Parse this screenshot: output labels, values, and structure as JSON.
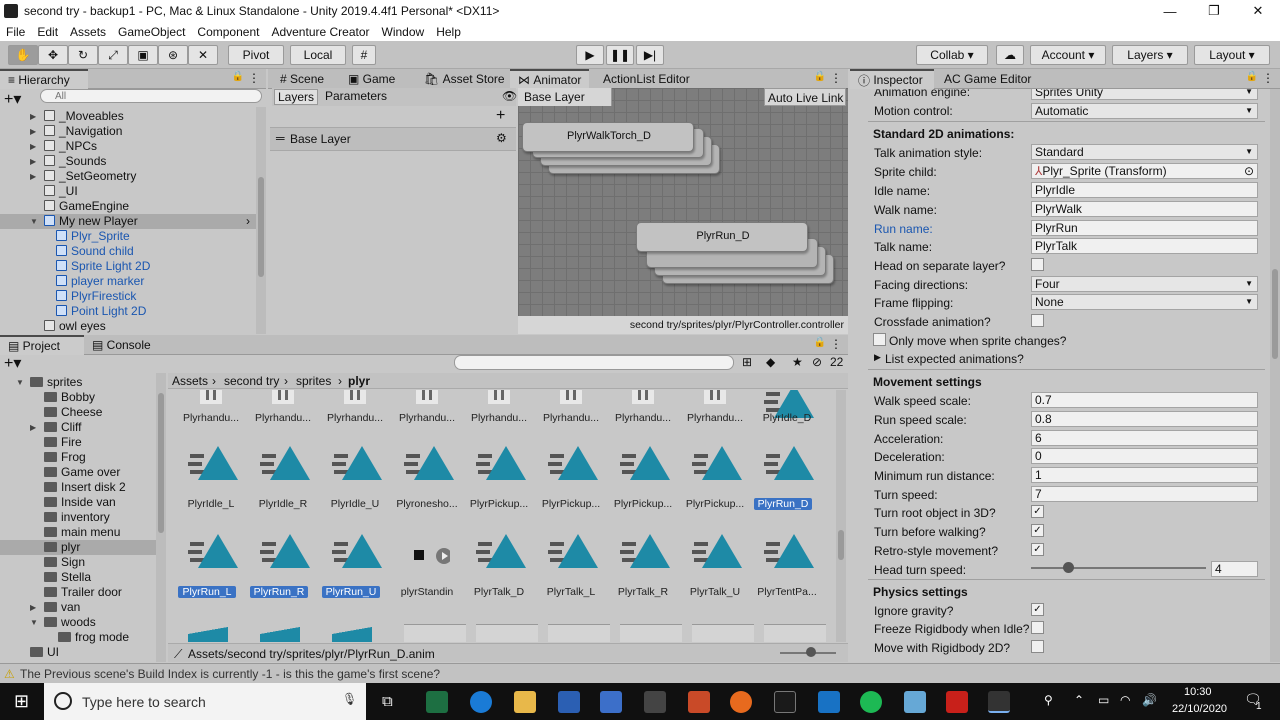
{
  "window": {
    "title": "second try - backup1 - PC, Mac & Linux Standalone - Unity 2019.4.4f1 Personal* <DX11>",
    "min_glyph": "—",
    "max_glyph": "❐",
    "close_glyph": "✕"
  },
  "menu": [
    "File",
    "Edit",
    "Assets",
    "GameObject",
    "Component",
    "Adventure Creator",
    "Window",
    "Help"
  ],
  "toolbar": {
    "pivot": "Pivot",
    "local": "Local",
    "collab": "Collab ▾",
    "account": "Account",
    "layers": "Layers",
    "layout": "Layout"
  },
  "hierarchy": {
    "tab": "Hierarchy",
    "search_placeholder": "All",
    "items": [
      {
        "label": "_Moveables",
        "indent": 1,
        "arrow": "▶",
        "blue": false,
        "cube": true
      },
      {
        "label": "_Navigation",
        "indent": 1,
        "arrow": "▶",
        "blue": false,
        "cube": true
      },
      {
        "label": "_NPCs",
        "indent": 1,
        "arrow": "▶",
        "blue": false,
        "cube": true
      },
      {
        "label": "_Sounds",
        "indent": 1,
        "arrow": "▶",
        "blue": false,
        "cube": true
      },
      {
        "label": "_SetGeometry",
        "indent": 1,
        "arrow": "▶",
        "blue": false,
        "cube": true
      },
      {
        "label": "_UI",
        "indent": 1,
        "arrow": "",
        "blue": false,
        "cube": true
      },
      {
        "label": "GameEngine",
        "indent": 1,
        "arrow": "",
        "blue": false,
        "cube": true
      },
      {
        "label": "My new Player",
        "indent": 1,
        "arrow": "▼",
        "blue": false,
        "cube": true,
        "selected": true
      },
      {
        "label": "Plyr_Sprite",
        "indent": 2,
        "arrow": "",
        "blue": true,
        "cube": true
      },
      {
        "label": "Sound child",
        "indent": 2,
        "arrow": "",
        "blue": true,
        "cube": true
      },
      {
        "label": "Sprite Light 2D",
        "indent": 2,
        "arrow": "",
        "blue": true,
        "cube": true
      },
      {
        "label": "player marker",
        "indent": 2,
        "arrow": "",
        "blue": true,
        "cube": true
      },
      {
        "label": "PlyrFirestick",
        "indent": 2,
        "arrow": "",
        "blue": true,
        "cube": true
      },
      {
        "label": "Point Light 2D",
        "indent": 2,
        "arrow": "",
        "blue": true,
        "cube": true
      },
      {
        "label": "owl eyes",
        "indent": 1,
        "arrow": "",
        "blue": false,
        "cube": true
      }
    ]
  },
  "center_tabs": [
    "Scene",
    "Game",
    "Asset Store",
    "Animator",
    "ActionList Editor"
  ],
  "animator": {
    "layers_tab": "Layers",
    "parameters_tab": "Parameters",
    "base_layer": "Base Layer",
    "breadcrumb": "Base Layer",
    "auto_live": "Auto Live Link",
    "node1": "PlyrWalkTorch_D",
    "node2": "PlyrRun_D",
    "path": "second try/sprites/plyr/PlyrController.controller"
  },
  "project": {
    "tab_project": "Project",
    "tab_console": "Console",
    "count": "22",
    "breadcrumb": [
      "Assets",
      "second try",
      "sprites",
      "plyr"
    ],
    "folders": [
      {
        "label": "sprites",
        "indent": 1,
        "arrow": "▼"
      },
      {
        "label": "Bobby",
        "indent": 2,
        "arrow": ""
      },
      {
        "label": "Cheese",
        "indent": 2,
        "arrow": ""
      },
      {
        "label": "Cliff",
        "indent": 2,
        "arrow": "▶"
      },
      {
        "label": "Fire",
        "indent": 2,
        "arrow": ""
      },
      {
        "label": "Frog",
        "indent": 2,
        "arrow": ""
      },
      {
        "label": "Game over",
        "indent": 2,
        "arrow": ""
      },
      {
        "label": "Insert disk 2",
        "indent": 2,
        "arrow": ""
      },
      {
        "label": "Inside van",
        "indent": 2,
        "arrow": ""
      },
      {
        "label": "inventory",
        "indent": 2,
        "arrow": ""
      },
      {
        "label": "main menu",
        "indent": 2,
        "arrow": ""
      },
      {
        "label": "plyr",
        "indent": 2,
        "arrow": "",
        "selected": true
      },
      {
        "label": "Sign",
        "indent": 2,
        "arrow": ""
      },
      {
        "label": "Stella",
        "indent": 2,
        "arrow": ""
      },
      {
        "label": "Trailer door",
        "indent": 2,
        "arrow": ""
      },
      {
        "label": "van",
        "indent": 2,
        "arrow": "▶"
      },
      {
        "label": "woods",
        "indent": 2,
        "arrow": "▼"
      },
      {
        "label": "frog mode",
        "indent": 3,
        "arrow": ""
      },
      {
        "label": "UI",
        "indent": 1,
        "arrow": ""
      }
    ],
    "row0": [
      "Plyrhandu...",
      "Plyrhandu...",
      "Plyrhandu...",
      "Plyrhandu...",
      "Plyrhandu...",
      "Plyrhandu...",
      "Plyrhandu...",
      "Plyrhandu...",
      "PlyrIdle_D"
    ],
    "row1": [
      "PlyrIdle_L",
      "PlyrIdle_R",
      "PlyrIdle_U",
      "Plyronesho...",
      "PlyrPickup...",
      "PlyrPickup...",
      "PlyrPickup...",
      "PlyrPickup...",
      "PlyrRun_D"
    ],
    "row1_sel": [
      false,
      false,
      false,
      false,
      false,
      false,
      false,
      false,
      true
    ],
    "row2": [
      "PlyrRun_L",
      "PlyrRun_R",
      "PlyrRun_U",
      "plyrStandin",
      "PlyrTalk_D",
      "PlyrTalk_L",
      "PlyrTalk_R",
      "PlyrTalk_U",
      "PlyrTentPa..."
    ],
    "row2_sel": [
      true,
      true,
      true,
      false,
      false,
      false,
      false,
      false,
      false
    ],
    "status_path": "Assets/second try/sprites/plyr/PlyrRun_D.anim"
  },
  "inspector": {
    "tab_inspector": "Inspector",
    "tab_ac": "AC Game Editor",
    "animation_engine_label": "Animation engine:",
    "animation_engine": "Sprites Unity",
    "motion_control_label": "Motion control:",
    "motion_control": "Automatic",
    "std2d_head": "Standard 2D animations:",
    "talk_style_label": "Talk animation style:",
    "talk_style": "Standard",
    "sprite_child_label": "Sprite child:",
    "sprite_child": "Plyr_Sprite (Transform)",
    "idle_label": "Idle name:",
    "idle": "PlyrIdle",
    "walk_label": "Walk name:",
    "walk": "PlyrWalk",
    "run_label": "Run name:",
    "run": "PlyrRun",
    "talk_label": "Talk name:",
    "talk": "PlyrTalk",
    "head_sep_label": "Head on separate layer?",
    "facing_label": "Facing directions:",
    "facing": "Four",
    "flip_label": "Frame flipping:",
    "flip": "None",
    "crossfade_label": "Crossfade animation?",
    "only_move_label": "Only move when sprite changes?",
    "list_expected": "List expected animations?",
    "movement_head": "Movement settings",
    "walk_speed_label": "Walk speed scale:",
    "walk_speed": "0.7",
    "run_speed_label": "Run speed scale:",
    "run_speed": "0.8",
    "accel_label": "Acceleration:",
    "accel": "6",
    "decel_label": "Deceleration:",
    "decel": "0",
    "min_run_label": "Minimum run distance:",
    "min_run": "1",
    "turn_speed_label": "Turn speed:",
    "turn_speed": "7",
    "turn_root_label": "Turn root object in 3D?",
    "turn_before_label": "Turn before walking?",
    "retro_label": "Retro-style movement?",
    "head_turn_label": "Head turn speed:",
    "head_turn": "4",
    "physics_head": "Physics settings",
    "ignore_gravity_label": "Ignore gravity?",
    "freeze_label": "Freeze Rigidbody when Idle?",
    "move_rb_label": "Move with Rigidbody 2D?"
  },
  "statusbar": "The Previous scene's Build Index is currently -1 - is this the game's first scene?",
  "taskbar": {
    "search_placeholder": "Type here to search",
    "time": "10:30",
    "date": "22/10/2020",
    "notif": "1"
  }
}
